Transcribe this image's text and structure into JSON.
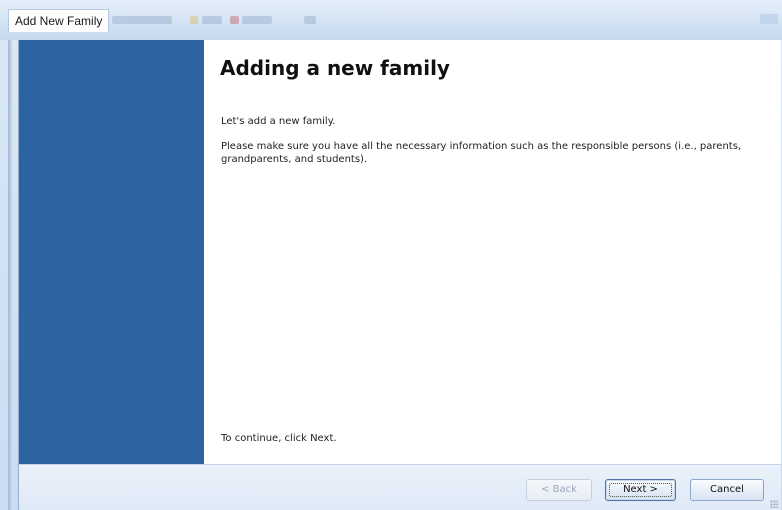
{
  "window": {
    "title": "Add New Family"
  },
  "wizard": {
    "heading": "Adding a new family",
    "intro": "Let's add a new family.",
    "info": "Please make sure you have all the necessary information such as the responsible persons (i.e., parents, grandparents, and students).",
    "continue_hint": "To continue, click Next."
  },
  "buttons": {
    "back_label": "< Back",
    "next_label": "Next >",
    "cancel_label": "Cancel"
  },
  "colors": {
    "side_panel": "#2d63a1",
    "chrome": "#dbe8f6",
    "content_bg": "#ffffff"
  }
}
